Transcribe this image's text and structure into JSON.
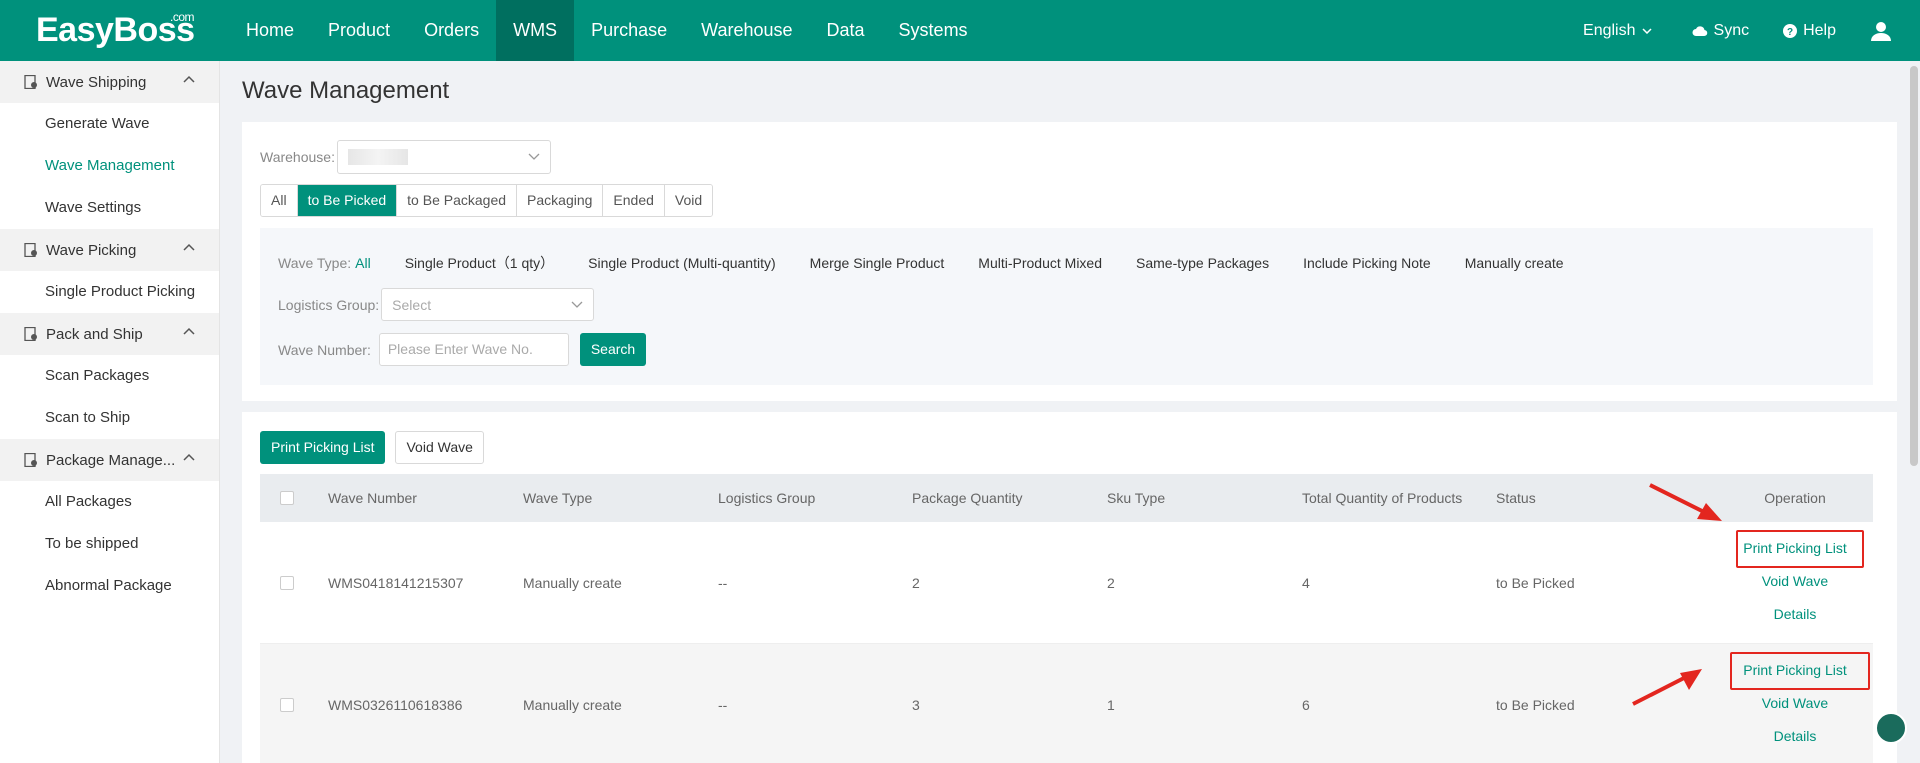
{
  "brand": {
    "name": "EasyBoss",
    "suffix": ".com"
  },
  "nav": [
    {
      "label": "Home"
    },
    {
      "label": "Product"
    },
    {
      "label": "Orders"
    },
    {
      "label": "WMS"
    },
    {
      "label": "Purchase"
    },
    {
      "label": "Warehouse"
    },
    {
      "label": "Data"
    },
    {
      "label": "Systems"
    }
  ],
  "topright": {
    "language": "English",
    "sync": "Sync",
    "help": "Help"
  },
  "sidebar": {
    "groups": [
      {
        "title": "Wave Shipping",
        "items": [
          "Generate Wave",
          "Wave Management",
          "Wave Settings"
        ]
      },
      {
        "title": "Wave Picking",
        "items": [
          "Single Product Picking"
        ]
      },
      {
        "title": "Pack and Ship",
        "items": [
          "Scan Packages",
          "Scan to Ship"
        ]
      },
      {
        "title": "Package Manage...",
        "items": [
          "All Packages",
          "To be shipped",
          "Abnormal Package"
        ]
      }
    ]
  },
  "page": {
    "title": "Wave Management"
  },
  "filters": {
    "warehouse_label": "Warehouse:",
    "tabs": [
      "All",
      "to Be Picked",
      "to Be Packaged",
      "Packaging",
      "Ended",
      "Void"
    ],
    "wave_type_label": "Wave Type:",
    "wave_types": [
      "All",
      "Single Product（1 qty）",
      "Single Product (Multi-quantity)",
      "Merge Single Product",
      "Multi-Product Mixed",
      "Same-type Packages",
      "Include Picking Note",
      "Manually create"
    ],
    "logistics_label": "Logistics Group:",
    "logistics_placeholder": "Select",
    "wave_number_label": "Wave Number:",
    "wave_number_placeholder": "Please Enter Wave  No.",
    "search_label": "Search"
  },
  "actions": {
    "print": "Print Picking List",
    "void": "Void Wave"
  },
  "table": {
    "columns": [
      "Wave Number",
      "Wave Type",
      "Logistics Group",
      "Package Quantity",
      "Sku Type",
      "Total Quantity of Products",
      "Status",
      "Operation"
    ],
    "rows": [
      {
        "wave_number": "WMS0418141215307",
        "wave_type": "Manually create",
        "logistics_group": "--",
        "package_qty": "2",
        "sku_type": "2",
        "total_qty": "4",
        "status": "to Be Picked"
      },
      {
        "wave_number": "WMS0326110618386",
        "wave_type": "Manually create",
        "logistics_group": "--",
        "package_qty": "3",
        "sku_type": "1",
        "total_qty": "6",
        "status": "to Be Picked"
      }
    ],
    "operations": [
      "Print Picking List",
      "Void Wave",
      "Details"
    ]
  },
  "colors": {
    "brand": "#00917c",
    "annotation": "#e3261f"
  }
}
